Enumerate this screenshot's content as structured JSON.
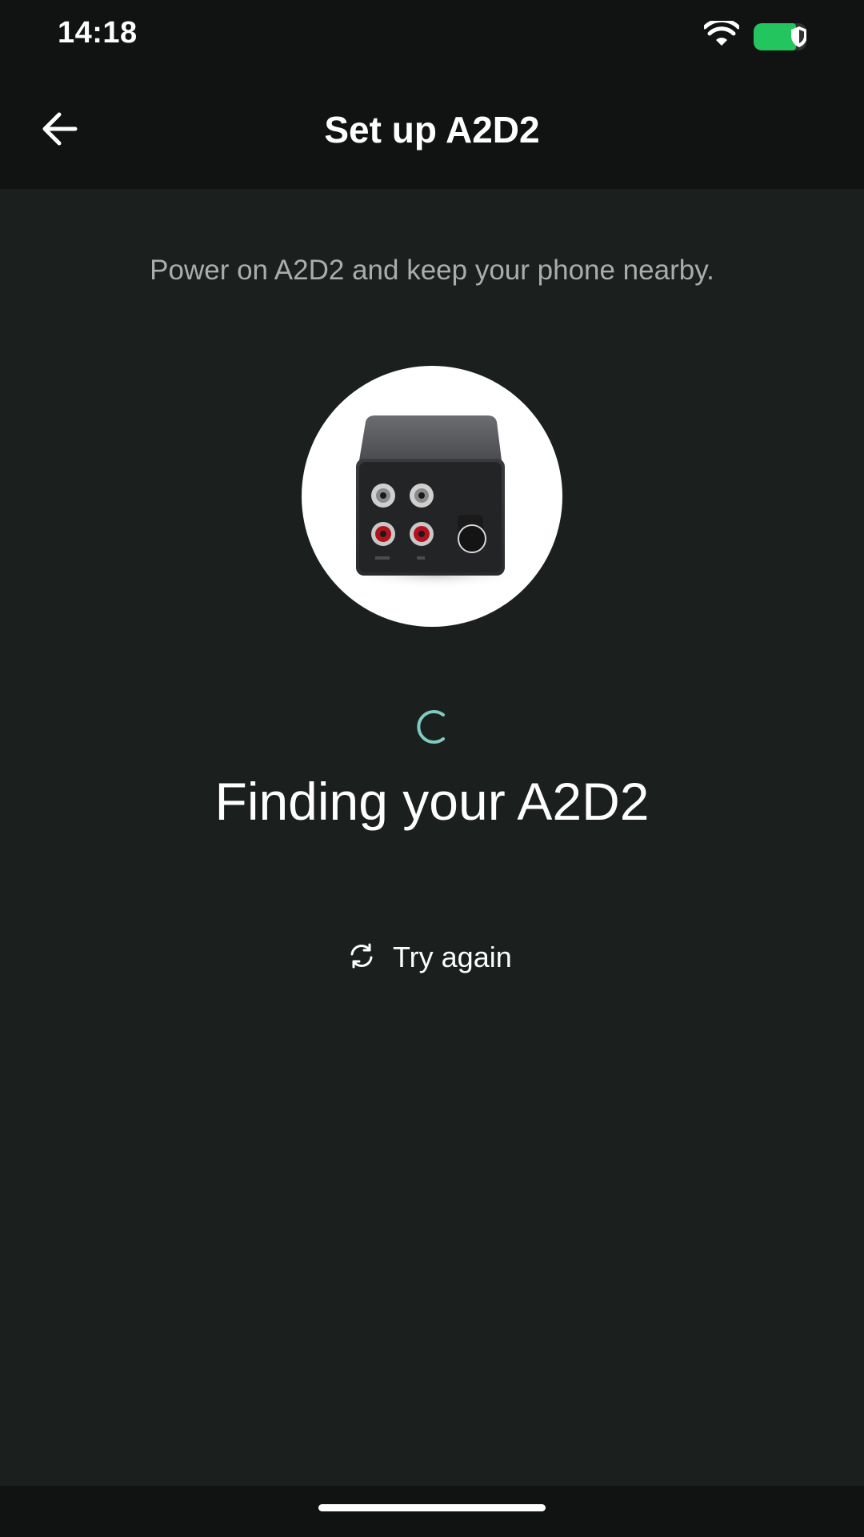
{
  "status_bar": {
    "time": "14:18",
    "battery_color": "#22c55e",
    "icons": [
      "wifi-icon",
      "battery-icon",
      "shield-icon"
    ]
  },
  "app_bar": {
    "title": "Set up A2D2",
    "back_icon": "arrow-left-icon"
  },
  "main": {
    "instruction": "Power on A2D2 and keep your phone nearby.",
    "device_image": "a2d2-device",
    "spinner_color": "#7ecbc0",
    "status_title": "Finding your A2D2",
    "try_again_label": "Try again",
    "try_again_icon": "refresh-icon"
  },
  "colors": {
    "background": "#1b1f1d",
    "bar_background": "#111312",
    "secondary_text": "#a9aeab",
    "accent": "#7ecbc0"
  }
}
